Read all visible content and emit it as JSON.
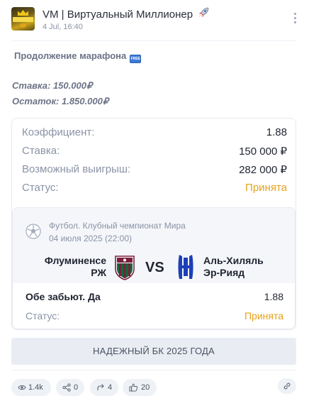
{
  "channel": {
    "title": "VM | Виртуальный Миллионер",
    "title_icon": "rocket-icon",
    "time": "4 Jul, 16:40"
  },
  "post": {
    "heading": "Продолжение марафона",
    "heading_badge": "FREE",
    "stake_line": "Ставка: 150.000₽",
    "balance_line": "Остаток: 1.850.000₽"
  },
  "bet": {
    "rows": [
      {
        "label": "Коэффициент:",
        "value": "1.88"
      },
      {
        "label": "Ставка:",
        "value": "150 000 ₽"
      },
      {
        "label": "Возможный выигрыш:",
        "value": "282 000 ₽"
      },
      {
        "label": "Статус:",
        "value": "Принята"
      }
    ],
    "status_color": "#e7a11b"
  },
  "match": {
    "sport": "Футбол. Клубный чемпионат Мира",
    "date": "04 июля 2025 (22:00)",
    "team_a": {
      "line1": "Флуминенсе",
      "line2": "РЖ",
      "colors": [
        "#7a1f3d",
        "#0f6b3a",
        "#ffffff"
      ]
    },
    "vs": "VS",
    "team_b": {
      "line1": "Аль-Хиляль",
      "line2": "Эр-Рияд",
      "color": "#1d3fb8"
    },
    "outcome": {
      "label": "Обе забьют. Да",
      "odds": "1.88"
    },
    "status": {
      "label": "Статус:",
      "value": "Принята"
    }
  },
  "banner": {
    "text": "НАДЕЖНЫЙ БК 2025 ГОДА"
  },
  "footer": {
    "views": "1.4k",
    "shares": "0",
    "forwards": "4",
    "likes": "20",
    "icons": [
      "eye-icon",
      "share-icon",
      "forward-icon",
      "thumbs-up-icon",
      "link-icon"
    ]
  }
}
